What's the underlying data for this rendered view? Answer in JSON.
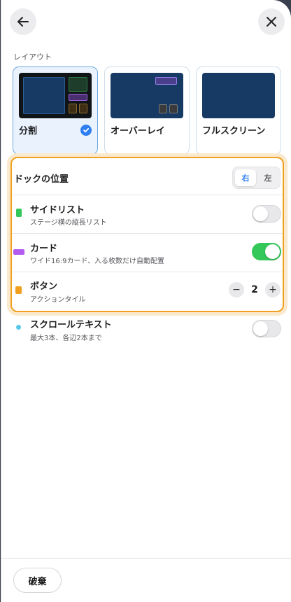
{
  "nav": {
    "back_icon": "arrow-left-icon",
    "close_icon": "close-icon"
  },
  "layout": {
    "label": "レイアウト",
    "options": [
      {
        "label": "分割",
        "selected": true
      },
      {
        "label": "オーバーレイ",
        "selected": false
      },
      {
        "label": "フルスクリーン",
        "selected": false
      }
    ]
  },
  "dock": {
    "title": "ドックの位置",
    "options": [
      "右",
      "左"
    ],
    "selected": "右"
  },
  "rows": {
    "sidelist": {
      "title": "サイドリスト",
      "subtitle": "ステージ横の縦長リスト",
      "enabled": false,
      "color": "#34c759"
    },
    "card": {
      "title": "カード",
      "subtitle": "ワイド16:9カード、入る枚数だけ自動配置",
      "enabled": true,
      "color": "#b45cf0"
    },
    "button": {
      "title": "ボタン",
      "subtitle": "アクションタイル",
      "count": "2",
      "minus": "−",
      "plus": "+",
      "color": "#f0a020"
    },
    "scroll": {
      "title": "スクロールテキスト",
      "subtitle": "最大3本、各辺2本まで",
      "enabled": false,
      "color": "#5ac8e8"
    }
  },
  "footer": {
    "discard_label": "破棄"
  },
  "colors": {
    "accent": "#2f7ef0",
    "highlight": "#f0a020",
    "toggle_on": "#34c759"
  }
}
